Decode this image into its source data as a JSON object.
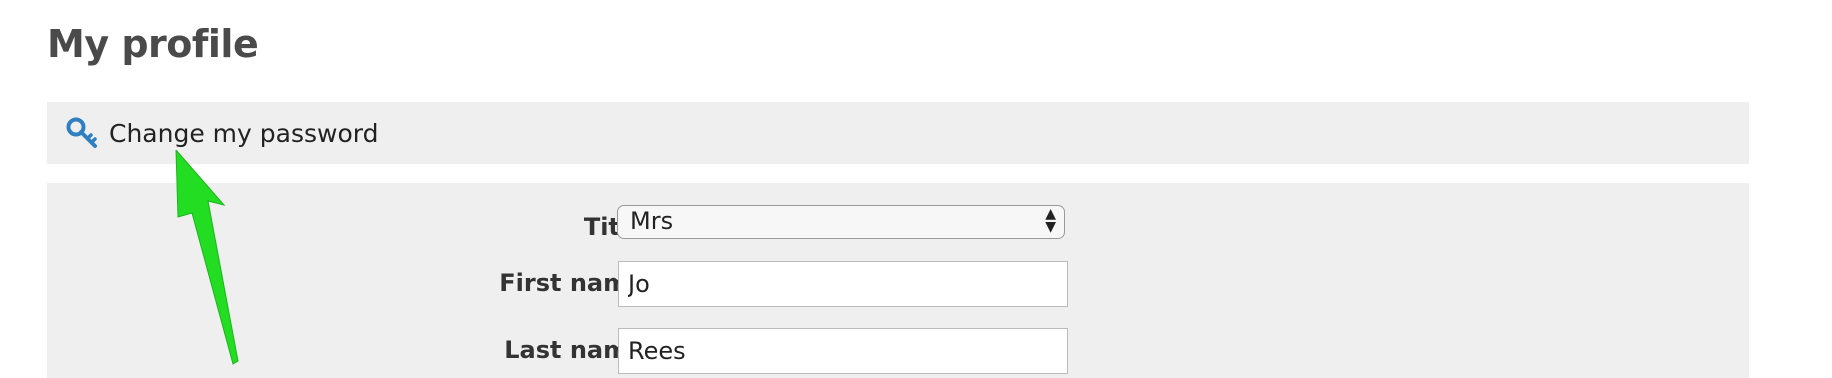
{
  "page": {
    "title": "My profile"
  },
  "password_bar": {
    "icon": "key-icon",
    "label": "Change my password",
    "icon_color": "#2f7fc1"
  },
  "form": {
    "title": {
      "label": "Title:",
      "value": "Mrs"
    },
    "first_name": {
      "label": "First name:",
      "value": "Jo"
    },
    "last_name": {
      "label": "Last name:",
      "value": "Rees"
    }
  },
  "annotation": {
    "arrow_color": "#22dd22"
  }
}
